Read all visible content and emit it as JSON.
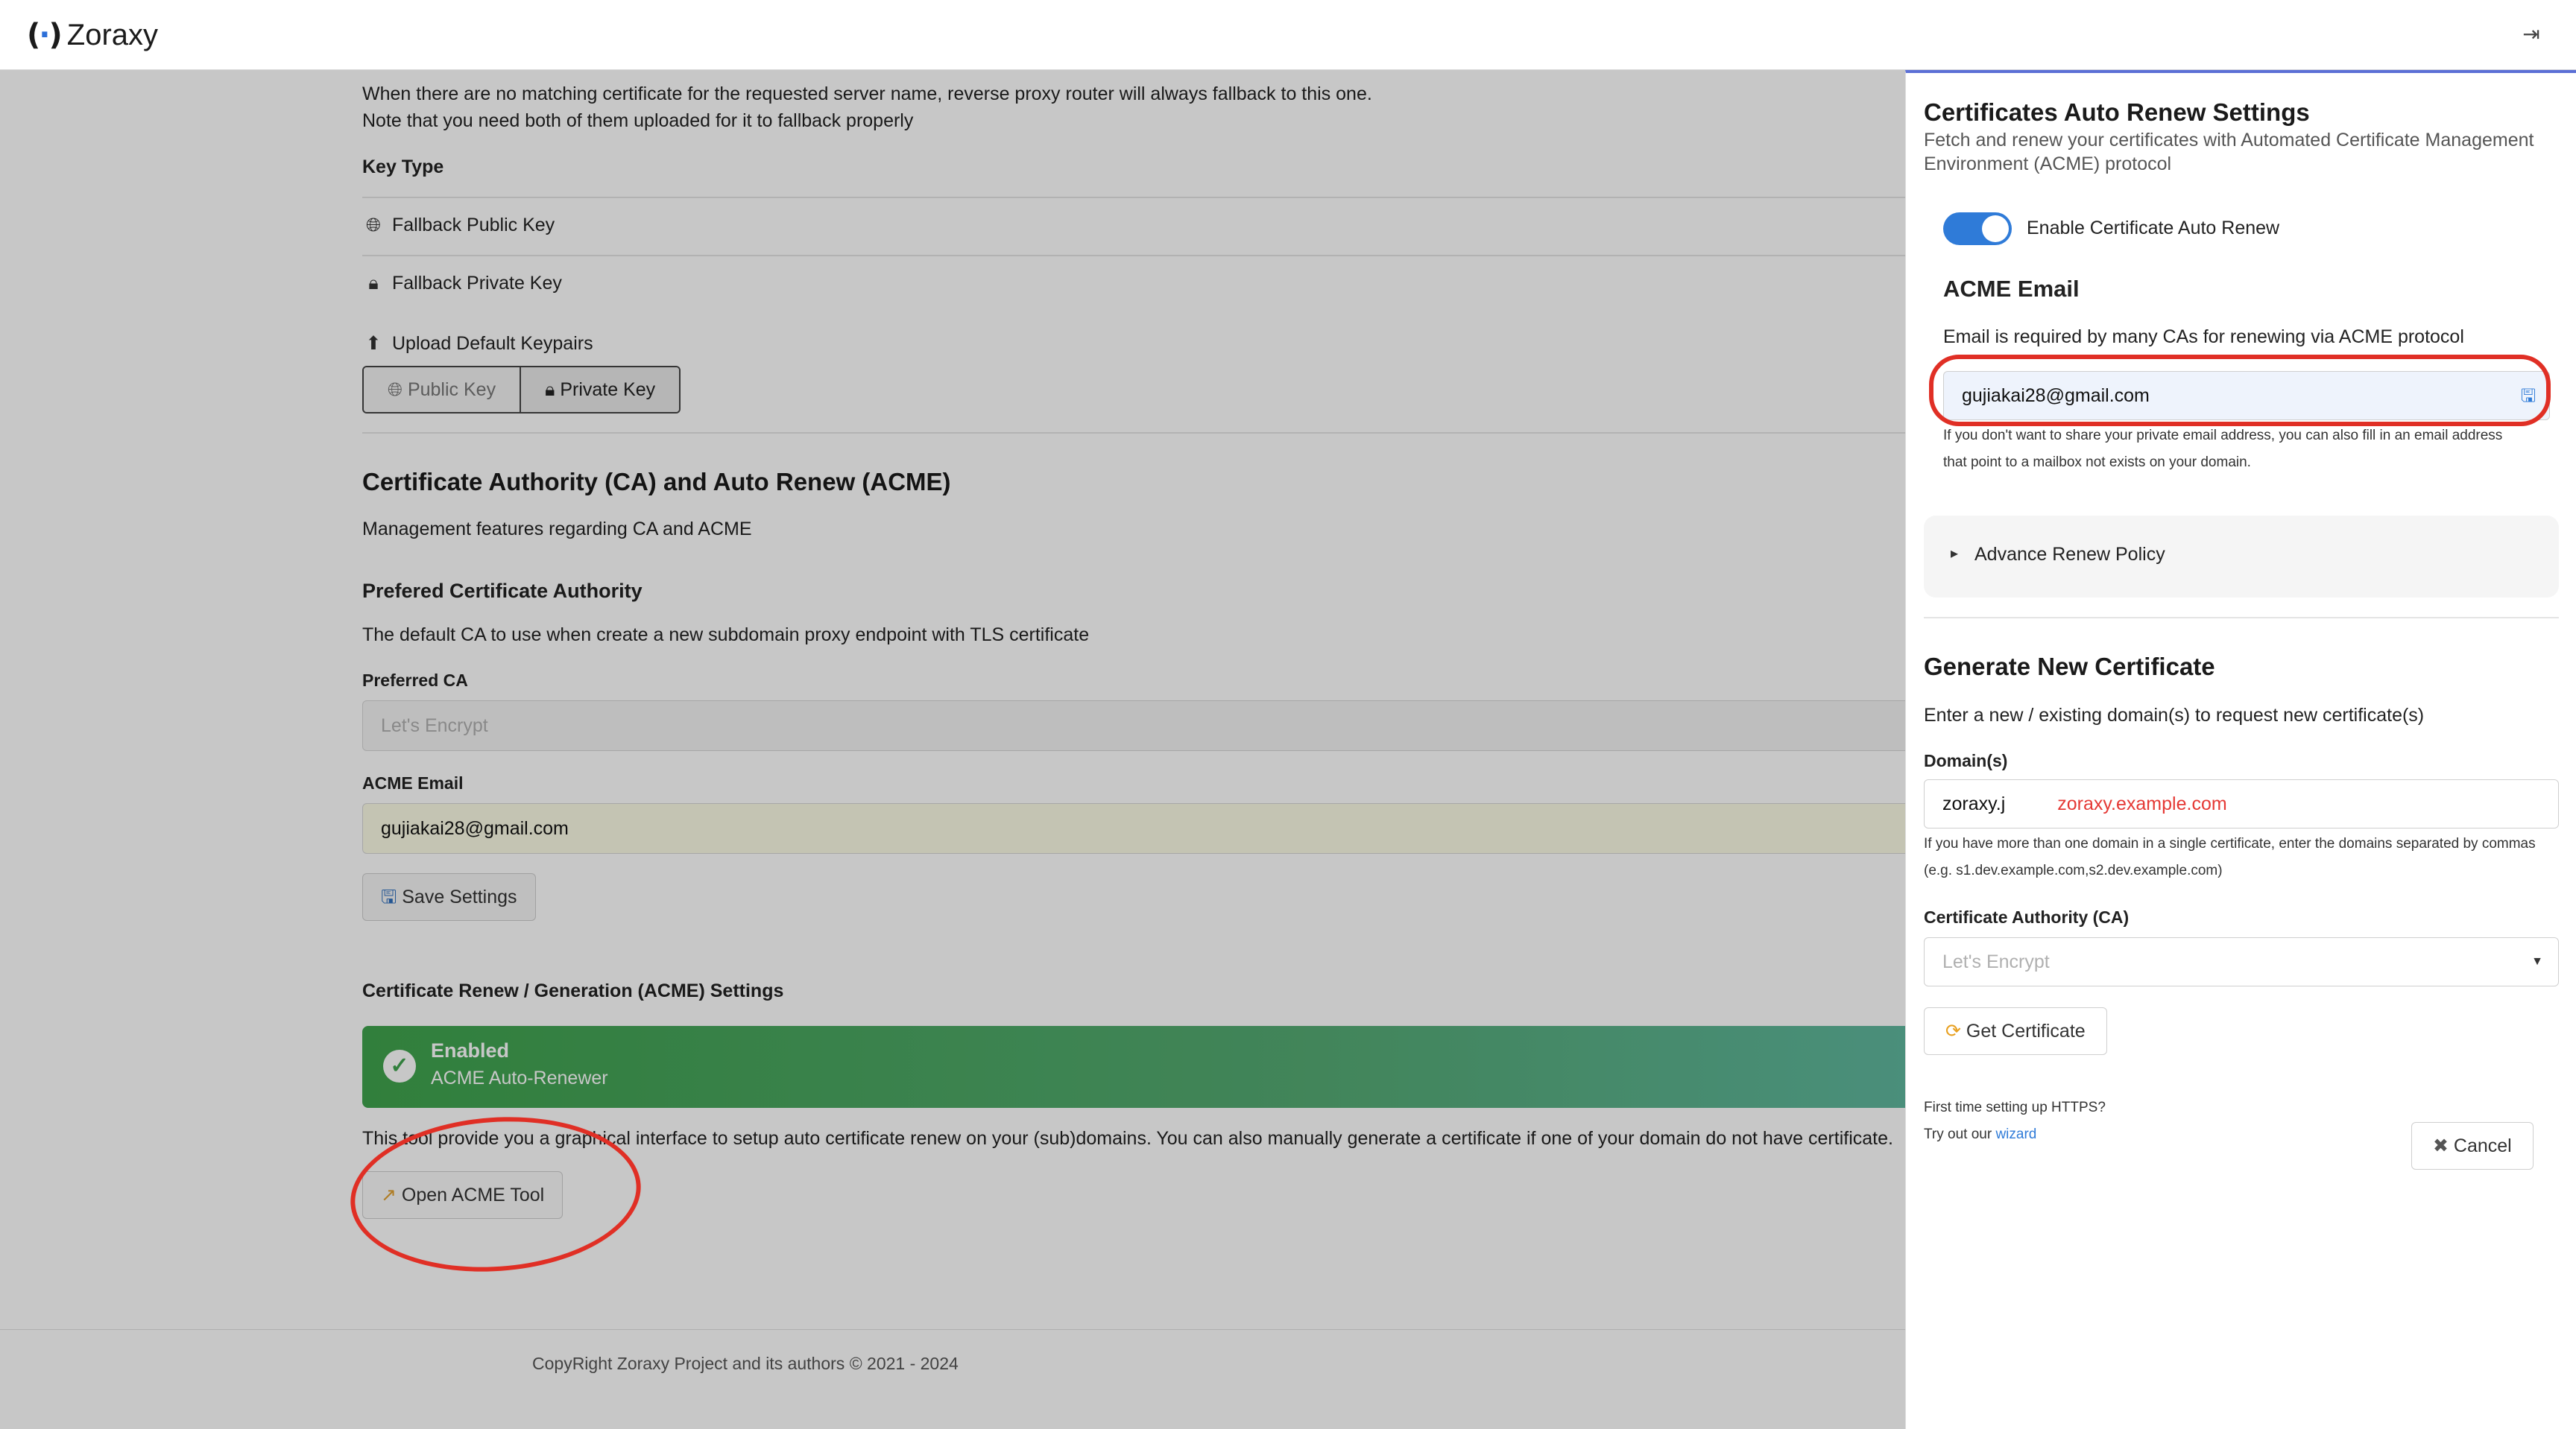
{
  "header": {
    "logo_text": "Zoraxy",
    "logout_icon": "sign-out-icon"
  },
  "main": {
    "fallback_note_1": "When there are no matching certificate for the requested server name, reverse proxy router will always fallback to this one.",
    "fallback_note_2": "Note that you need both of them uploaded for it to fallback properly",
    "key_type_label": "Key Type",
    "fallback_public_key": "Fallback Public Key",
    "fallback_private_key": "Fallback Private Key",
    "upload_keypairs": "Upload Default Keypairs",
    "public_key_btn": "Public Key",
    "private_key_btn": "Private Key",
    "ca_section_title": "Certificate Authority (CA) and Auto Renew (ACME)",
    "ca_section_desc": "Management features regarding CA and ACME",
    "preferred_ca_heading": "Prefered Certificate Authority",
    "preferred_ca_desc": "The default CA to use when create a new subdomain proxy endpoint with TLS certificate",
    "preferred_ca_label": "Preferred CA",
    "preferred_ca_value": "Let's Encrypt",
    "acme_email_label": "ACME Email",
    "acme_email_value": "gujiakai28@gmail.com",
    "save_settings_btn": "Save Settings",
    "renew_settings_heading": "Certificate Renew / Generation (ACME) Settings",
    "status_title": "Enabled",
    "status_sub": "ACME Auto-Renewer",
    "tool_desc": "This tool provide you a graphical interface to setup auto certificate renew on your (sub)domains. You can also manually generate a certificate if one of your domain do not have certificate.",
    "open_acme_btn": "Open ACME Tool",
    "footer": "CopyRight Zoraxy Project and its authors © 2021 - 2024"
  },
  "panel": {
    "title": "Certificates Auto Renew Settings",
    "subtitle_1": "Fetch and renew your certificates with Automated Certificate Management",
    "subtitle_2": "Environment (ACME) protocol",
    "toggle_label": "Enable Certificate Auto Renew",
    "acme_email_heading": "ACME Email",
    "acme_email_desc": "Email is required by many CAs for renewing via ACME protocol",
    "acme_email_value": "gujiakai28@gmail.com",
    "email_hint_1": "If you don't want to share your private email address, you can also fill in an email address",
    "email_hint_2": "that point to a mailbox not exists on your domain.",
    "advance_policy": "Advance Renew Policy",
    "gen_title": "Generate New Certificate",
    "gen_desc": "Enter a new / existing domain(s) to request new certificate(s)",
    "domains_label": "Domain(s)",
    "domains_value": "zoraxy.j",
    "domains_example": "zoraxy.example.com",
    "domains_hint_1": "If you have more than one domain in a single certificate, enter the domains separated by commas",
    "domains_hint_2": "(e.g. s1.dev.example.com,s2.dev.example.com)",
    "ca_label": "Certificate Authority (CA)",
    "ca_value": "Let's Encrypt",
    "get_cert_btn": "Get Certificate",
    "https_q": "First time setting up HTTPS?",
    "try_out": "Try out our",
    "wizard_link": "wizard",
    "cancel_btn": "Cancel"
  },
  "colors": {
    "accent": "#2f7bd8",
    "status_green": "#3fa34d",
    "annotation_red": "#e02f25"
  }
}
